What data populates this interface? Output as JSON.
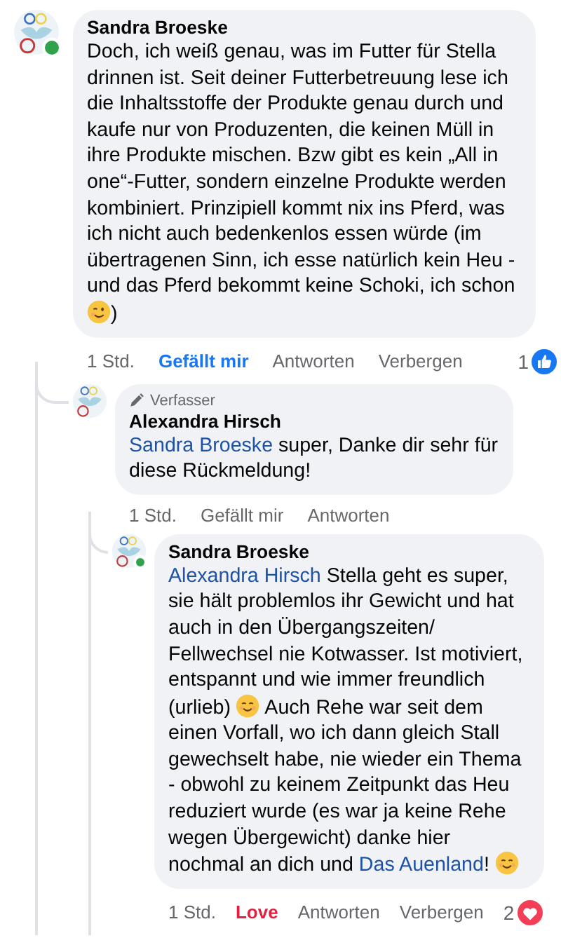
{
  "comments": [
    {
      "author": "Sandra Broeske",
      "online": true,
      "body": [
        {
          "kind": "text",
          "text": "Doch, ich weiß genau, was im Futter für Stella drinnen ist. Seit deiner Futterbetreuung lese ich die Inhaltsstoffe der Produkte genau durch und kaufe nur von Produzenten, die keinen Müll in ihre Produkte mischen. Bzw gibt es kein „All in one“-Futter, sondern einzelne Produkte werden kombiniert. Prinzipiell kommt nix ins Pferd, was ich nicht auch bedenkenlos essen würde (im übertragenen Sinn, ich esse natürlich kein Heu - und das Pferd bekommt keine Schoki, ich schon "
        },
        {
          "kind": "wink"
        },
        {
          "kind": "text",
          "text": ")"
        }
      ],
      "time": "1 Std.",
      "reaction": {
        "label": "Gefällt mir",
        "kind": "like",
        "selected": true
      },
      "links": [
        "Antworten",
        "Verbergen"
      ],
      "count": {
        "text": "1",
        "kind": "like"
      },
      "children": [
        {
          "author": "Alexandra Hirsch",
          "online": false,
          "badge": "Verfasser",
          "body": [
            {
              "kind": "mention",
              "text": "Sandra Broeske"
            },
            {
              "kind": "text",
              "text": " super, Danke dir sehr für diese Rückmeldung!"
            }
          ],
          "time": "1 Std.",
          "reaction": {
            "label": "Gefällt mir",
            "selected": false
          },
          "links": [
            "Antworten"
          ],
          "children": [
            {
              "author": "Sandra Broeske",
              "online": true,
              "body": [
                {
                  "kind": "mention",
                  "text": "Alexandra Hirsch"
                },
                {
                  "kind": "text",
                  "text": "  Stella geht es super, sie hält problemlos ihr Gewicht und hat auch in den Übergangszeiten/ Fellwechsel nie Kotwasser. Ist motiviert, entspannt und wie immer freundlich (urlieb) "
                },
                {
                  "kind": "smile"
                },
                {
                  "kind": "text",
                  "text": " Auch Rehe war seit dem einen Vorfall, wo ich dann gleich Stall gewechselt habe, nie wieder ein Thema - obwohl zu keinem Zeitpunkt das Heu reduziert wurde (es war ja keine Rehe wegen Übergewicht) danke hier nochmal an dich und "
                },
                {
                  "kind": "mention",
                  "text": "Das Auenland"
                },
                {
                  "kind": "text",
                  "text": "! "
                },
                {
                  "kind": "smile"
                }
              ],
              "time": "1 Std.",
              "reaction": {
                "label": "Love",
                "kind": "love",
                "selected": true
              },
              "links": [
                "Antworten",
                "Verbergen"
              ],
              "count": {
                "text": "2",
                "kind": "love"
              }
            }
          ]
        }
      ]
    }
  ]
}
